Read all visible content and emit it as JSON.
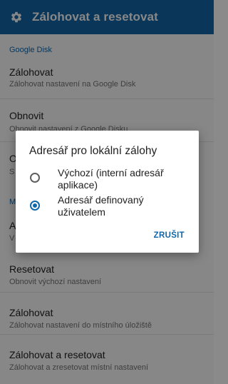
{
  "colors": {
    "primary": "#1167a8",
    "scrim": "rgba(0,0,0,0.47)"
  },
  "app_bar": {
    "icon": "gear-icon",
    "title": "Zálohovat a resetovat"
  },
  "sections": {
    "google_disk": {
      "header": "Google Disk",
      "items": [
        {
          "title": "Zálohovat",
          "summary": "Zálohovat nastavení na Google Disk"
        },
        {
          "title": "Obnovit",
          "summary": "Obnovit nastavení z Google Disku"
        },
        {
          "title": "O",
          "summary": "S"
        }
      ]
    },
    "local": {
      "header": "M",
      "items": [
        {
          "title": "A",
          "summary": "V"
        },
        {
          "title": "Resetovat",
          "summary": "Obnovit výchozí nastavení"
        },
        {
          "title": "Zálohovat",
          "summary": "Zálohovat nastavení do místního úložiště"
        },
        {
          "title": "Zálohovat a resetovat",
          "summary": "Zálohovat a zresetovat místní nastavení"
        }
      ]
    }
  },
  "dialog": {
    "title": "Adresář pro lokální zálohy",
    "options": [
      {
        "label": "Výchozí (interní adresář aplikace)",
        "selected": false
      },
      {
        "label": "Adresář definovaný uživatelem",
        "selected": true
      }
    ],
    "cancel_label": "ZRUŠIT"
  }
}
